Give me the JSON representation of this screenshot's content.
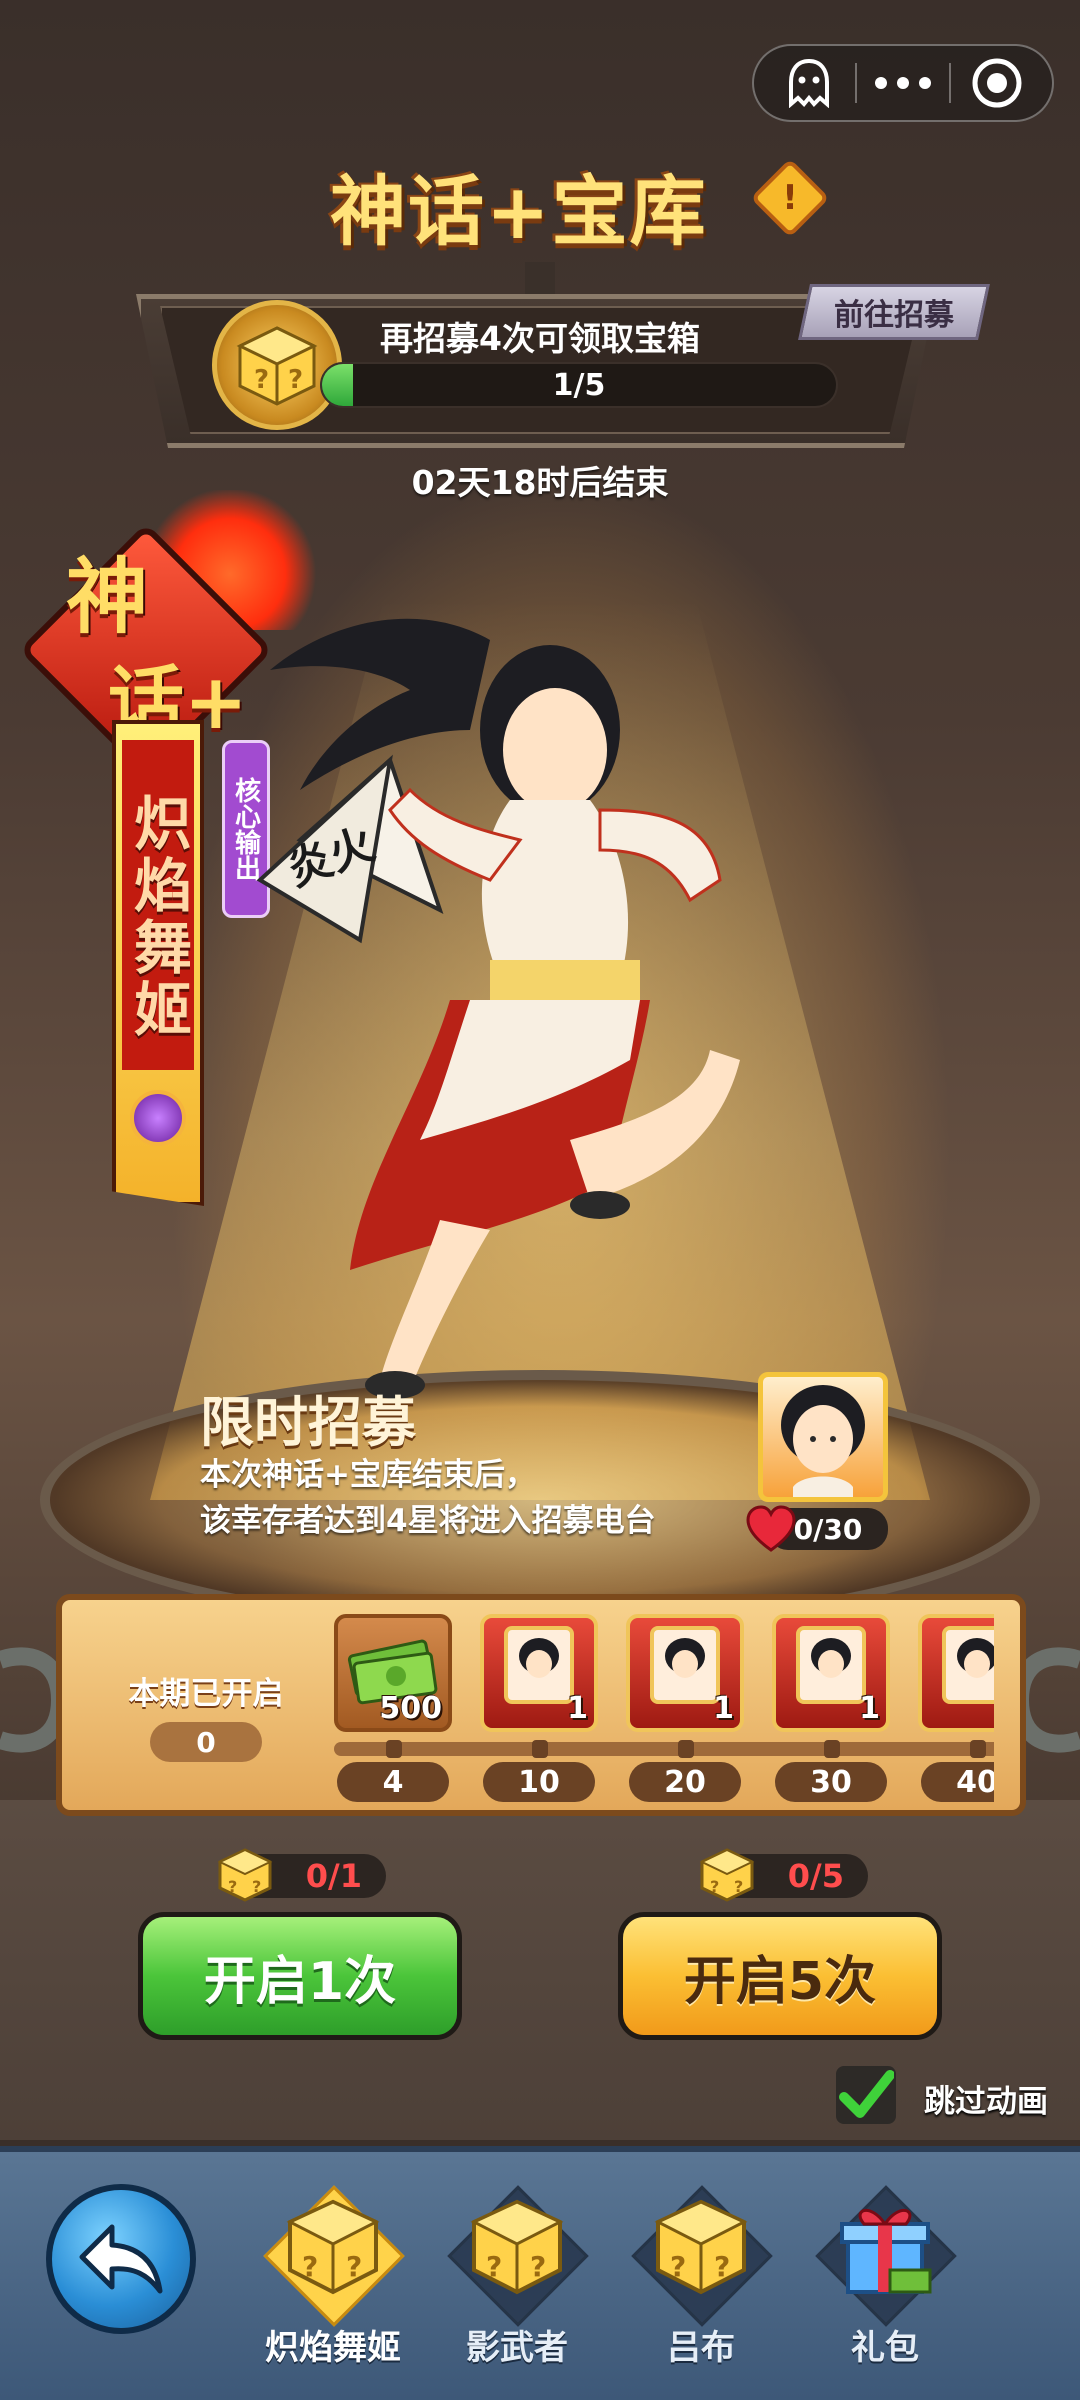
{
  "header": {
    "title": "神话+宝库",
    "info_icon_label": "!"
  },
  "capsule": {
    "icons": [
      "ghost-icon",
      "more-icon",
      "target-icon"
    ]
  },
  "progress_panel": {
    "label": "再招募4次可领取宝箱",
    "progress_text": "1/5",
    "progress_fraction": 0.06,
    "goto_button": "前往招募",
    "timer": "02天18时后结束"
  },
  "hero": {
    "rarity_line1": "神",
    "rarity_line2": "话+",
    "name": "炽焰舞姬",
    "role": "核心输出",
    "fan_text": "炎火"
  },
  "limited_recruit": {
    "title": "限时招募",
    "desc_line1": "本次神话+宝库结束后，",
    "desc_line2": "该幸存者达到4星将进入招募电台",
    "shard_count": "0/30"
  },
  "milestones": {
    "label": "本期已开启",
    "count": "0",
    "rewards": [
      {
        "type": "cash",
        "qty": "500",
        "threshold": "4"
      },
      {
        "type": "card",
        "qty": "1",
        "threshold": "10"
      },
      {
        "type": "card",
        "qty": "1",
        "threshold": "20"
      },
      {
        "type": "card",
        "qty": "1",
        "threshold": "30"
      },
      {
        "type": "card",
        "qty": "",
        "threshold": "40"
      }
    ]
  },
  "actions": {
    "open1_cost": "0/1",
    "open1_label": "开启1次",
    "open5_cost": "0/5",
    "open5_label": "开启5次",
    "skip_label": "跳过动画",
    "skip_checked": true
  },
  "nav": {
    "items": [
      {
        "label": "炽焰舞姬",
        "icon": "mystery-box-icon",
        "active": true
      },
      {
        "label": "影武者",
        "icon": "mystery-box-icon",
        "active": false
      },
      {
        "label": "吕布",
        "icon": "mystery-box-icon",
        "active": false
      },
      {
        "label": "礼包",
        "icon": "gift-box-icon",
        "active": false
      }
    ]
  },
  "colors": {
    "title_gold": "#ffe27a",
    "green_button": "#4bc53a",
    "gold_button": "#fbbf33",
    "cost_red": "#ff4d4d",
    "nav_blue": "#4a6685"
  }
}
